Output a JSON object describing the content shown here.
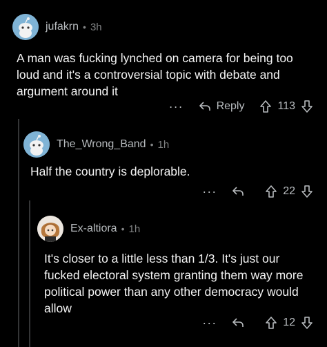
{
  "comments": [
    {
      "username": "jufakrn",
      "age": "3h",
      "body": "A man was fucking lynched on camera for being too loud and it's a controversial topic with debate and argument around it",
      "reply_label": "Reply",
      "votes": "113",
      "avatar_icon": "snoo-avatar-icon"
    },
    {
      "username": "The_Wrong_Band",
      "age": "1h",
      "body": "Half the country is deplorable.",
      "votes": "22",
      "avatar_icon": "snoo-avatar-icon"
    },
    {
      "username": "Ex-altiora",
      "age": "1h",
      "body": "It's closer to a little less than 1/3. It's just our fucked electoral system granting them way more political power than any other democracy would allow",
      "votes": "12",
      "avatar_icon": "custom-avatar-icon"
    }
  ],
  "separator": "•",
  "more_glyph": "···",
  "colors": {
    "background": "#000000",
    "username": "#b8bcbf",
    "text": "#f3f3f3",
    "thread_line": "#343536"
  }
}
